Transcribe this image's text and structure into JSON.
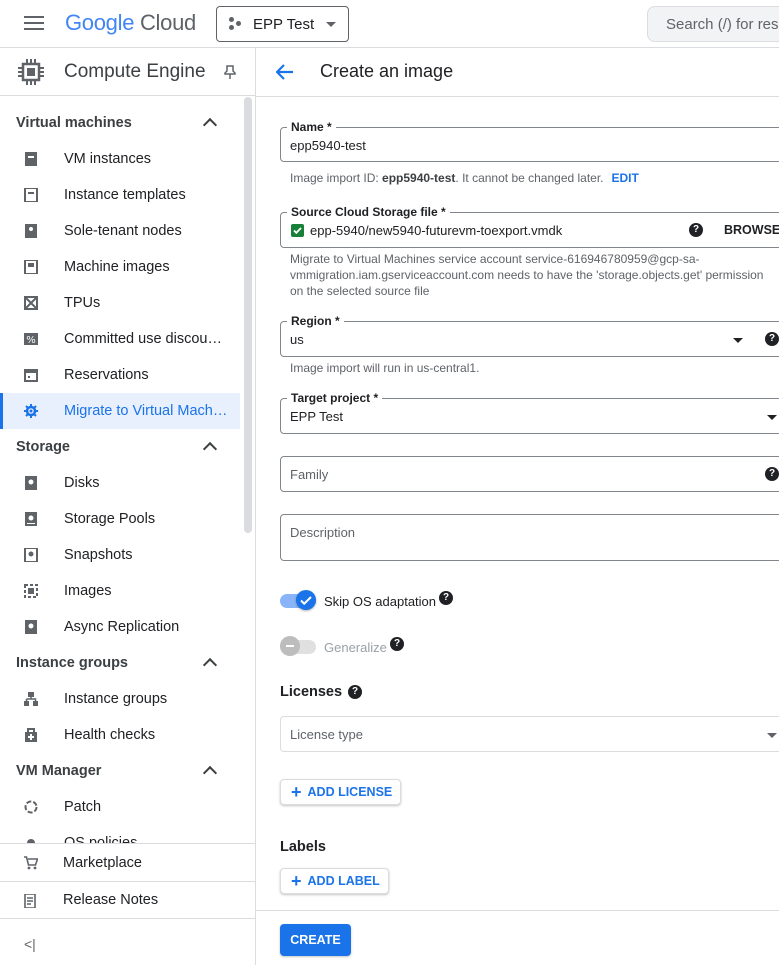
{
  "topbar": {
    "logo_google": "Google",
    "logo_cloud": "Cloud",
    "project": "EPP Test",
    "search_placeholder": "Search (/) for resources"
  },
  "sidebar": {
    "title": "Compute Engine",
    "sections": {
      "vm": "Virtual machines",
      "storage": "Storage",
      "instance_groups": "Instance groups",
      "vm_manager": "VM Manager"
    },
    "items": {
      "vm_instances": "VM instances",
      "instance_templates": "Instance templates",
      "sole_tenant": "Sole-tenant nodes",
      "machine_images": "Machine images",
      "tpus": "TPUs",
      "committed": "Committed use discou…",
      "reservations": "Reservations",
      "migrate": "Migrate to Virtual Machi…",
      "disks": "Disks",
      "storage_pools": "Storage Pools",
      "snapshots": "Snapshots",
      "images": "Images",
      "async_replication": "Async Replication",
      "instance_groups": "Instance groups",
      "health_checks": "Health checks",
      "patch": "Patch",
      "os_policies": "OS policies"
    },
    "bottom": {
      "marketplace": "Marketplace",
      "release_notes": "Release Notes",
      "collapse": "<|"
    }
  },
  "main": {
    "title": "Create an image",
    "name": {
      "label": "Name *",
      "value": "epp5940-test"
    },
    "name_hint_prefix": "Image import ID: ",
    "name_hint_id": "epp5940-test",
    "name_hint_suffix": ". It cannot be changed later.",
    "edit": "EDIT",
    "source": {
      "label": "Source Cloud Storage file *",
      "value": "epp-5940/new5940-futurevm-toexport.vmdk",
      "browse": "BROWSE"
    },
    "source_hint_1": "Migrate to Virtual Machines service account service-616946780959@gcp-sa-",
    "source_hint_2": "vmmigration.iam.gserviceaccount.com needs to have the 'storage.objects.get' permission",
    "source_hint_3": "on the selected source file",
    "region": {
      "label": "Region *",
      "value": "us"
    },
    "region_hint": "Image import will run in us-central1.",
    "target": {
      "label": "Target project *",
      "value": "EPP Test"
    },
    "family_placeholder": "Family",
    "description_placeholder": "Description",
    "skip_os": "Skip OS adaptation",
    "generalize": "Generalize",
    "licenses_heading": "Licenses",
    "license_type_placeholder": "License type",
    "add_license": "ADD LICENSE",
    "labels_heading": "Labels",
    "add_label": "ADD LABEL",
    "create": "CREATE",
    "help_glyph": "?"
  },
  "colors": {
    "accent": "#1a73e8",
    "active_bg": "#e8f0fe",
    "checkbox": "#188038"
  }
}
